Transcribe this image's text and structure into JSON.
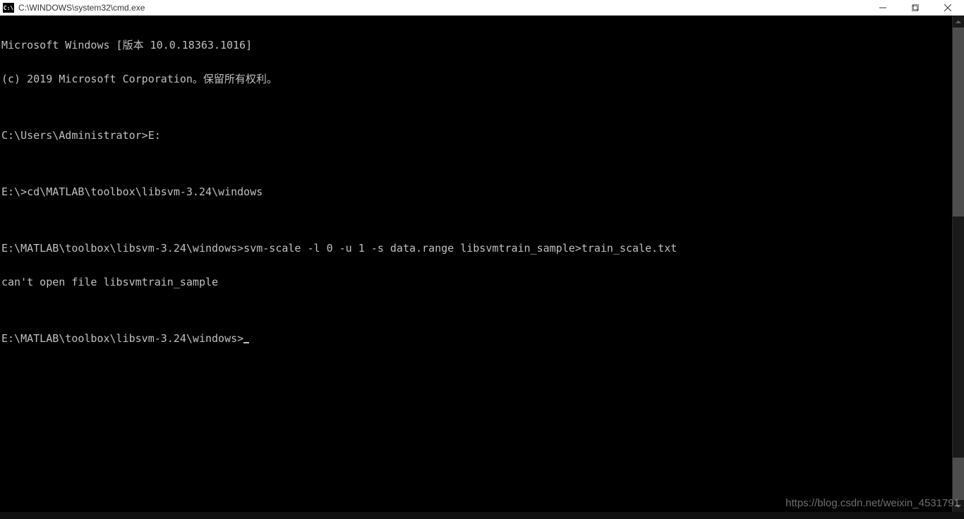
{
  "titlebar": {
    "icon_label": "C:\\",
    "title": "C:\\WINDOWS\\system32\\cmd.exe"
  },
  "terminal": {
    "lines": [
      "Microsoft Windows [版本 10.0.18363.1016]",
      "(c) 2019 Microsoft Corporation。保留所有权利。",
      "",
      "C:\\Users\\Administrator>E:",
      "",
      "E:\\>cd\\MATLAB\\toolbox\\libsvm-3.24\\windows",
      "",
      "E:\\MATLAB\\toolbox\\libsvm-3.24\\windows>svm-scale -l 0 -u 1 -s data.range libsvmtrain_sample>train_scale.txt",
      "can't open file libsvmtrain_sample",
      "",
      "E:\\MATLAB\\toolbox\\libsvm-3.24\\windows>"
    ]
  },
  "watermark": "https://blog.csdn.net/weixin_4531791"
}
